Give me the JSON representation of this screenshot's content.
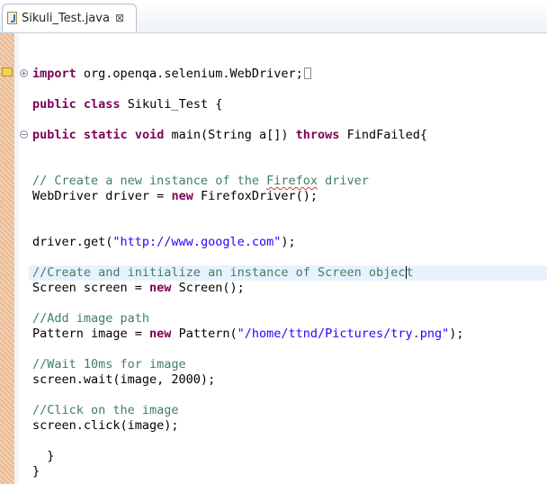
{
  "tab": {
    "title": "Sikuli_Test.java",
    "close": "⊠"
  },
  "code": {
    "import_kw": "import",
    "import_rest": " org.openqa.selenium.WebDriver;",
    "class_kw1": "public",
    "class_kw2": "class",
    "class_rest": " Sikuli_Test {",
    "main_kw1": "public",
    "main_kw2": "static",
    "main_kw3": "void",
    "main_mid": " main(String a[]) ",
    "main_kw4": "throws",
    "main_rest": " FindFailed{",
    "c1_a": "// Create a new instance of the ",
    "c1_b": "Firefox",
    "c1_c": " driver",
    "drv_a": "WebDriver driver = ",
    "drv_kw": "new",
    "drv_b": " FirefoxDriver();",
    "get_a": "driver.get(",
    "get_str": "\"http://www.google.com\"",
    "get_b": ");",
    "c2_a": "//Create and initialize an instance of Screen objec",
    "c2_b": "t",
    "scr_a": "Screen screen = ",
    "scr_kw": "new",
    "scr_b": " Screen();",
    "c3": "//Add image path",
    "pat_a": "Pattern image = ",
    "pat_kw": "new",
    "pat_b": " Pattern(",
    "pat_str": "\"/home/ttnd/Pictures/try.png\"",
    "pat_c": ");",
    "c4": "//Wait 10ms for image",
    "wait": "screen.wait(image, 2000);",
    "c5": "//Click on the image",
    "click": "screen.click(image);",
    "close_inner": "  }",
    "close_outer": "}"
  },
  "fold_markers": {
    "collapsed": "+",
    "expanded": "−"
  }
}
